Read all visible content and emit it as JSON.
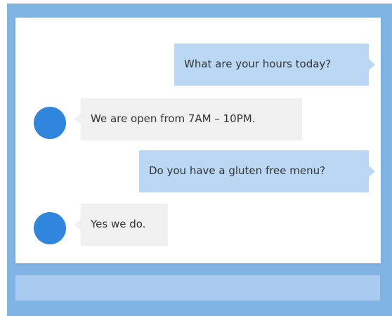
{
  "colors": {
    "frame": "#7fb4e4",
    "panel": "#ffffff",
    "user_bubble": "#bad8f3",
    "bot_bubble": "#f0f0f0",
    "avatar": "#2f86dc",
    "input_bar": "#a9cbef"
  },
  "messages": [
    {
      "sender": "user",
      "text": "What are your hours today?"
    },
    {
      "sender": "bot",
      "text": "We are open from 7AM – 10PM."
    },
    {
      "sender": "user",
      "text": "Do you have a gluten free menu?"
    },
    {
      "sender": "bot",
      "text": "Yes we do."
    }
  ],
  "input": {
    "value": "",
    "placeholder": ""
  }
}
